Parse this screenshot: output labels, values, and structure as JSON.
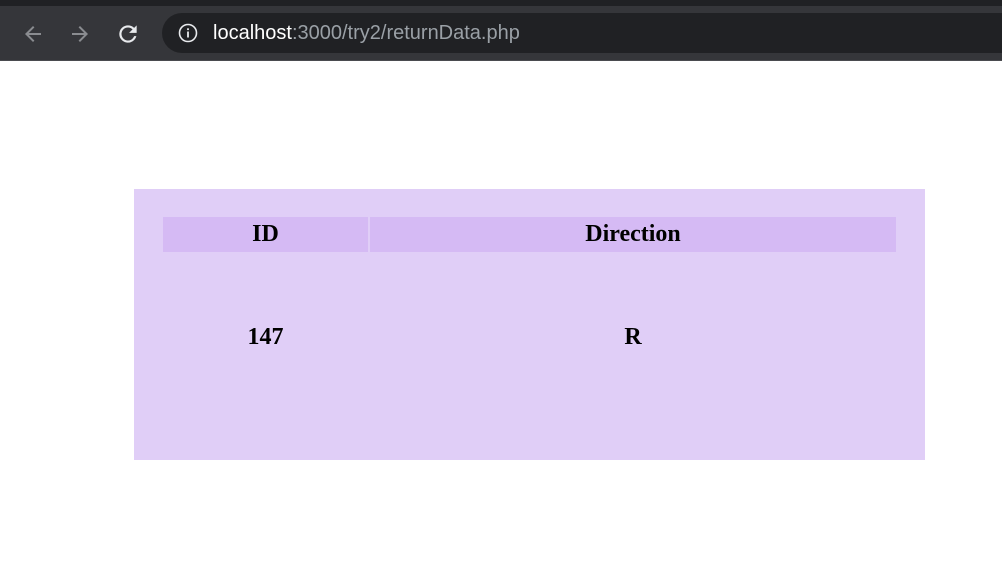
{
  "browser": {
    "url_host": "localhost",
    "url_path": ":3000/try2/returnData.php",
    "icons": {
      "back": "arrow-left-icon",
      "forward": "arrow-right-icon",
      "reload": "reload-icon",
      "info": "info-icon"
    }
  },
  "table": {
    "headers": [
      "ID",
      "Direction"
    ],
    "rows": [
      [
        "147",
        "R"
      ]
    ]
  },
  "colors": {
    "panel_background": "#e0cef7",
    "header_background": "#d5baf4"
  }
}
